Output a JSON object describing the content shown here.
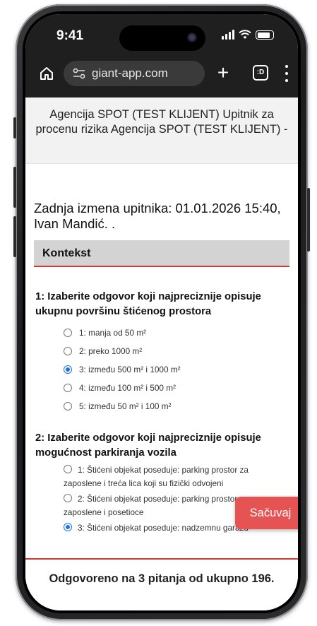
{
  "status_bar": {
    "time": "9:41"
  },
  "browser": {
    "url": "giant-app.com",
    "plus_label": "+",
    "tabs_label": ":D"
  },
  "page": {
    "title": "Agencija SPOT (TEST KLIJENT) Upitnik za procenu rizika Agencija SPOT (TEST KLIJENT) -",
    "last_edit": "Zadnja izmena upitnika: 01.01.2026 15:40, Ivan Mandić. .",
    "section_label": "Kontekst"
  },
  "questions": [
    {
      "text": "1: Izaberite odgovor koji najpreciznije opisuje ukupnu površinu štićenog prostora",
      "answers": [
        {
          "label": "1: manja od 50 m²",
          "selected": false
        },
        {
          "label": "2: preko 1000 m²",
          "selected": false
        },
        {
          "label": "3: između 500 m² i 1000 m²",
          "selected": true
        },
        {
          "label": "4: između 100 m² i 500 m²",
          "selected": false
        },
        {
          "label": "5: između 50 m² i 100 m²",
          "selected": false
        }
      ]
    },
    {
      "text": "2: Izaberite odgovor koji najpreciznije opisuje mogućnost parkiranja vozila",
      "answers": [
        {
          "label": "1: Štićeni objekat poseduje: parking prostor za zaposlene i treća lica koji su fizički odvojeni",
          "selected": false
        },
        {
          "label": "2: Štićeni objekat poseduje: parking prostor za zaposlene i posetioce",
          "selected": false
        },
        {
          "label": "3: Štićeni objekat poseduje: nadzemnu garažu",
          "selected": true
        }
      ]
    }
  ],
  "save_button": "Sačuvaj",
  "footer": "Odgovoreno na 3 pitanja od ukupno 196."
}
